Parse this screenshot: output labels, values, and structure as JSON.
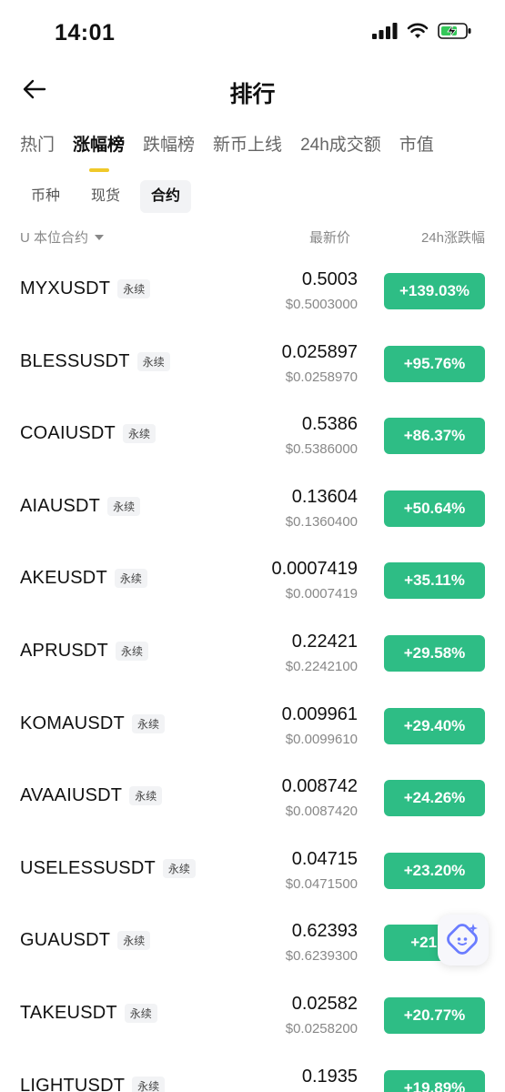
{
  "status": {
    "time": "14:01"
  },
  "header": {
    "title": "排行"
  },
  "main_tabs": [
    {
      "label": "热门"
    },
    {
      "label": "涨幅榜"
    },
    {
      "label": "跌幅榜"
    },
    {
      "label": "新币上线"
    },
    {
      "label": "24h成交额"
    },
    {
      "label": "市值"
    }
  ],
  "active_main_tab": "涨幅榜",
  "sub_tabs": [
    {
      "label": "币种"
    },
    {
      "label": "现货"
    },
    {
      "label": "合约"
    }
  ],
  "active_sub_tab": "合约",
  "columns": {
    "left": "U 本位合约",
    "mid": "最新价",
    "right": "24h涨跌幅"
  },
  "rows": [
    {
      "symbol": "MYXUSDT",
      "tag": "永续",
      "price": "0.5003",
      "fiat": "$0.5003000",
      "change": "+139.03%"
    },
    {
      "symbol": "BLESSUSDT",
      "tag": "永续",
      "price": "0.025897",
      "fiat": "$0.0258970",
      "change": "+95.76%"
    },
    {
      "symbol": "COAIUSDT",
      "tag": "永续",
      "price": "0.5386",
      "fiat": "$0.5386000",
      "change": "+86.37%"
    },
    {
      "symbol": "AIAUSDT",
      "tag": "永续",
      "price": "0.13604",
      "fiat": "$0.1360400",
      "change": "+50.64%"
    },
    {
      "symbol": "AKEUSDT",
      "tag": "永续",
      "price": "0.0007419",
      "fiat": "$0.0007419",
      "change": "+35.11%"
    },
    {
      "symbol": "APRUSDT",
      "tag": "永续",
      "price": "0.22421",
      "fiat": "$0.2242100",
      "change": "+29.58%"
    },
    {
      "symbol": "KOMAUSDT",
      "tag": "永续",
      "price": "0.009961",
      "fiat": "$0.0099610",
      "change": "+29.40%"
    },
    {
      "symbol": "AVAAIUSDT",
      "tag": "永续",
      "price": "0.008742",
      "fiat": "$0.0087420",
      "change": "+24.26%"
    },
    {
      "symbol": "USELESSUSDT",
      "tag": "永续",
      "price": "0.04715",
      "fiat": "$0.0471500",
      "change": "+23.20%"
    },
    {
      "symbol": "GUAUSDT",
      "tag": "永续",
      "price": "0.62393",
      "fiat": "$0.6239300",
      "change": "+21.__"
    },
    {
      "symbol": "TAKEUSDT",
      "tag": "永续",
      "price": "0.02582",
      "fiat": "$0.0258200",
      "change": "+20.77%"
    },
    {
      "symbol": "LIGHTUSDT",
      "tag": "永续",
      "price": "0.1935",
      "fiat": "",
      "change": "+19.89%"
    }
  ],
  "colors": {
    "accent": "#f0c929",
    "up": "#2ebd85"
  },
  "icons": {
    "back": "arrow-left-icon",
    "dropdown": "caret-down-icon",
    "assistant": "sparkle-face-icon"
  }
}
